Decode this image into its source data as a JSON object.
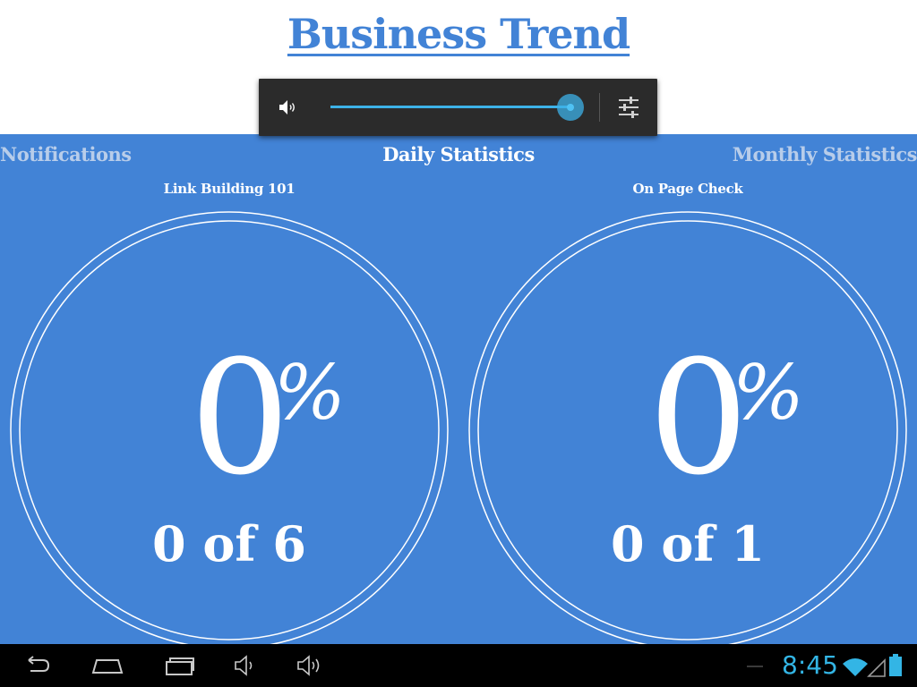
{
  "app": {
    "title": "Business Trend",
    "accent_color": "#4283d6"
  },
  "tabs": [
    {
      "label": "Notifications",
      "active": false
    },
    {
      "label": "Daily Statistics",
      "active": true
    },
    {
      "label": "Monthly Statistics",
      "active": false
    }
  ],
  "cards": [
    {
      "title": "Link Building 101",
      "percent": "0",
      "percent_symbol": "%",
      "progress_text": "0 of 6",
      "completed": 0,
      "total": 6
    },
    {
      "title": "On Page Check",
      "percent": "0",
      "percent_symbol": "%",
      "progress_text": "0 of 1",
      "completed": 0,
      "total": 1
    }
  ],
  "volume_popup": {
    "level": 1.0,
    "speaker_icon": "speaker-volume-icon",
    "settings_icon": "sliders-settings-icon",
    "accent_color": "#3db2e8"
  },
  "system_bar": {
    "time": "8:45",
    "icons": [
      "back-icon",
      "home-icon",
      "recent-apps-icon",
      "volume-down-icon",
      "volume-up-icon",
      "wifi-icon",
      "signal-icon",
      "battery-icon"
    ],
    "clock_color": "#33b5e5"
  }
}
